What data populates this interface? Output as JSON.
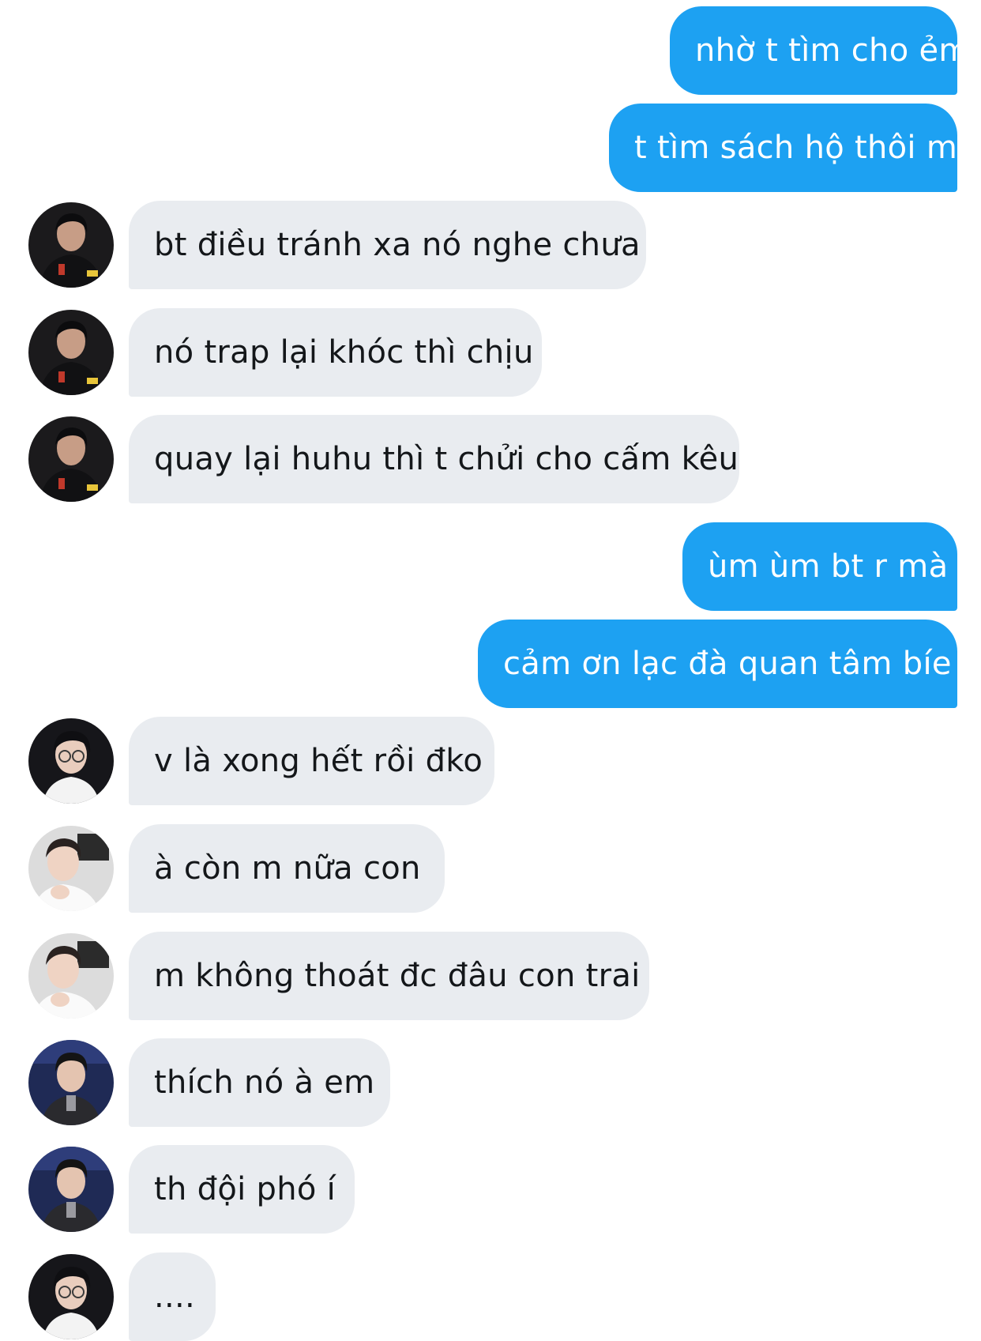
{
  "colors": {
    "outgoing_bubble": "#1da1f2",
    "incoming_bubble": "#e9ecf0",
    "outgoing_text": "#ffffff",
    "incoming_text": "#14171a"
  },
  "messages": [
    {
      "direction": "out",
      "text": "nhờ t tìm cho ẻm"
    },
    {
      "direction": "out",
      "text": "t tìm sách hộ thôi mò"
    },
    {
      "direction": "in",
      "avatar": "dark-hoodie-avatar",
      "text": "bt điều tránh xa nó nghe chưa"
    },
    {
      "direction": "in",
      "avatar": "dark-hoodie-avatar",
      "text": "nó trap lại khóc thì chịu"
    },
    {
      "direction": "in",
      "avatar": "dark-hoodie-avatar",
      "text": "quay lại huhu thì t chửi cho cấm kêu"
    },
    {
      "direction": "out",
      "text": "ùm ùm bt r mà"
    },
    {
      "direction": "out",
      "text": "cảm ơn lạc đà quan tâm bíe"
    },
    {
      "direction": "in",
      "avatar": "glasses-avatar",
      "text": "v là xong hết rồi đko"
    },
    {
      "direction": "in",
      "avatar": "white-shirt-avatar",
      "text": "à còn m nữa con"
    },
    {
      "direction": "in",
      "avatar": "white-shirt-avatar",
      "text": "m không thoát đc đâu con trai"
    },
    {
      "direction": "in",
      "avatar": "stage-avatar",
      "text": "thích nó à em"
    },
    {
      "direction": "in",
      "avatar": "stage-avatar",
      "text": "th đội phó í"
    },
    {
      "direction": "in",
      "avatar": "glasses-avatar",
      "text": "...."
    }
  ]
}
